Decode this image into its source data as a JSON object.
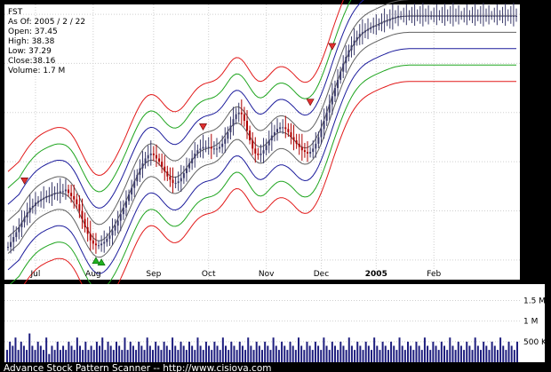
{
  "info": {
    "symbol": "FST",
    "as_of": "As Of: 2005 / 2 / 22",
    "open": "Open: 37.45",
    "high": "High: 38.38",
    "low": "Low: 37.29",
    "close": "Close:38.16",
    "volume": "Volume: 1.7 M"
  },
  "footer": {
    "text": "Advance Stock Pattern Scanner -- http://www.cisiova.com"
  },
  "colors": {
    "background": "#000000",
    "panel": "#ffffff",
    "candle_up": "#3a3a6a",
    "candle_down": "#b00000",
    "volume": "#1e1e7e",
    "band_outer": "#e21a1a",
    "band_mid": "#1fa51f",
    "band_inner": "#1c1c9c",
    "band_center": "#606060",
    "sell_marker": "#e03030",
    "buy_marker": "#20b020"
  },
  "chart_data": [
    {
      "type": "candlestick",
      "title": "FST",
      "x_labels": [
        {
          "label": "Jul",
          "index": 10
        },
        {
          "label": "Aug",
          "index": 31
        },
        {
          "label": "Sep",
          "index": 53
        },
        {
          "label": "Oct",
          "index": 73
        },
        {
          "label": "Nov",
          "index": 94
        },
        {
          "label": "Dec",
          "index": 114
        },
        {
          "label": "2005",
          "index": 134
        },
        {
          "label": "Feb",
          "index": 155
        }
      ],
      "ylim": [
        22.8,
        39.6
      ],
      "y_ticks": [
        24,
        27,
        30,
        33,
        36,
        39
      ],
      "grid": true,
      "closes": [
        24.8,
        25.1,
        25.4,
        25.7,
        26.0,
        26.3,
        26.6,
        26.9,
        27.2,
        27.3,
        27.5,
        27.6,
        27.7,
        27.8,
        27.9,
        27.9,
        28.0,
        28.1,
        28.1,
        28.2,
        28.2,
        28.3,
        28.1,
        27.9,
        27.7,
        27.4,
        27.0,
        26.5,
        26.0,
        25.6,
        25.2,
        25.0,
        24.9,
        24.9,
        25.0,
        25.1,
        25.3,
        25.5,
        25.8,
        26.1,
        26.4,
        26.8,
        27.2,
        27.6,
        28.0,
        28.4,
        28.8,
        29.2,
        29.6,
        29.9,
        30.2,
        30.4,
        30.5,
        30.4,
        30.2,
        30.0,
        29.7,
        29.4,
        29.1,
        28.9,
        28.7,
        28.7,
        28.8,
        29.0,
        29.3,
        29.6,
        29.9,
        30.2,
        30.5,
        30.7,
        30.8,
        30.9,
        30.9,
        30.9,
        30.8,
        30.8,
        30.8,
        30.9,
        31.1,
        31.4,
        31.8,
        32.2,
        32.6,
        32.9,
        33.0,
        32.9,
        32.5,
        31.9,
        31.3,
        30.8,
        30.5,
        30.4,
        30.5,
        30.7,
        31.0,
        31.3,
        31.6,
        31.8,
        32.0,
        32.1,
        32.1,
        32.0,
        31.8,
        31.5,
        31.3,
        31.1,
        30.9,
        30.7,
        30.6,
        30.5,
        30.6,
        30.8,
        31.1,
        31.5,
        32.0,
        32.5,
        33.0,
        33.5,
        34.0,
        34.5,
        35.0,
        35.5,
        36.0,
        36.4,
        36.8,
        37.1,
        37.4,
        37.6,
        37.8,
        37.9,
        38.0,
        38.1,
        38.2,
        38.3,
        38.3,
        38.4,
        38.5,
        38.6,
        38.6,
        38.7,
        38.8,
        38.8,
        38.9,
        38.9,
        38.9,
        38.9,
        38.9,
        38.9,
        38.9,
        38.9,
        38.9,
        38.9,
        38.9,
        38.9,
        38.9,
        38.9,
        38.9,
        38.9,
        38.9,
        38.9,
        38.9,
        38.9,
        38.9,
        38.9,
        38.9,
        38.9,
        38.9,
        38.9,
        38.9,
        38.9,
        38.9,
        38.9,
        38.9,
        38.9,
        38.9,
        38.9,
        38.9,
        38.9,
        38.9,
        38.9,
        38.9,
        38.9,
        38.9,
        38.9,
        38.9,
        38.9
      ],
      "band_offsets": [
        -4.0,
        -3.0,
        -2.0,
        -1.0,
        0,
        1.0,
        2.0,
        3.0,
        4.0
      ],
      "sell_signals": [
        {
          "index": 6,
          "price": 28.8
        },
        {
          "index": 71,
          "price": 32.1
        },
        {
          "index": 110,
          "price": 33.6
        },
        {
          "index": 118,
          "price": 37.0
        }
      ],
      "buy_signals": [
        {
          "index": 32,
          "price": 24.0
        },
        {
          "index": 34,
          "price": 23.9
        }
      ]
    },
    {
      "type": "bar",
      "title": "Volume",
      "ylim": [
        0,
        1.9
      ],
      "y_ticks": [
        {
          "label": "500 K",
          "value": 0.5
        },
        {
          "label": "1 M",
          "value": 1.0
        },
        {
          "label": "1.5 M",
          "value": 1.5
        }
      ],
      "values": [
        0.3,
        0.5,
        0.4,
        0.6,
        0.3,
        0.5,
        0.4,
        0.3,
        0.7,
        0.4,
        0.3,
        0.5,
        0.4,
        0.3,
        0.6,
        0.2,
        0.4,
        0.3,
        0.5,
        0.3,
        0.4,
        0.3,
        0.5,
        0.4,
        0.3,
        0.6,
        0.4,
        0.3,
        0.5,
        0.3,
        0.4,
        0.3,
        0.5,
        0.4,
        0.6,
        0.3,
        0.5,
        0.4,
        0.3,
        0.5,
        0.4,
        0.3,
        0.6,
        0.3,
        0.5,
        0.4,
        0.3,
        0.5,
        0.4,
        0.3,
        0.6,
        0.4,
        0.3,
        0.5,
        0.4,
        0.3,
        0.5,
        0.4,
        0.3,
        0.6,
        0.4,
        0.3,
        0.5,
        0.4,
        0.3,
        0.5,
        0.4,
        0.3,
        0.6,
        0.4,
        0.3,
        0.5,
        0.4,
        0.3,
        0.5,
        0.4,
        0.3,
        0.6,
        0.4,
        0.3,
        0.5,
        0.4,
        0.3,
        0.5,
        0.4,
        0.3,
        0.6,
        0.4,
        0.3,
        0.5,
        0.4,
        0.3,
        0.5,
        0.4,
        0.3,
        0.6,
        0.4,
        0.3,
        0.5,
        0.4,
        0.3,
        0.5,
        0.4,
        0.3,
        0.6,
        0.4,
        0.3,
        0.5,
        0.4,
        0.3,
        0.5,
        0.4,
        0.3,
        0.6,
        0.4,
        0.3,
        0.5,
        0.4,
        0.3,
        0.5,
        0.4,
        0.3,
        0.6,
        0.4,
        0.3,
        0.5,
        0.4,
        0.3,
        0.5,
        0.4,
        0.3,
        0.6,
        0.4,
        0.3,
        0.5,
        0.4,
        0.3,
        0.5,
        0.4,
        0.3,
        0.6,
        0.4,
        0.3,
        0.5,
        0.4,
        0.3,
        0.5,
        0.4,
        0.3,
        0.6,
        0.4,
        0.3,
        0.5,
        0.4,
        0.3,
        0.5,
        0.4,
        0.3,
        0.6,
        0.4,
        0.3,
        0.5,
        0.4,
        0.3,
        0.5,
        0.4,
        0.3,
        0.6,
        0.4,
        0.3,
        0.5,
        0.4,
        0.3,
        0.5,
        0.4,
        0.3,
        0.6,
        0.4,
        0.3,
        0.5,
        0.4,
        0.3,
        0.5
      ]
    }
  ]
}
